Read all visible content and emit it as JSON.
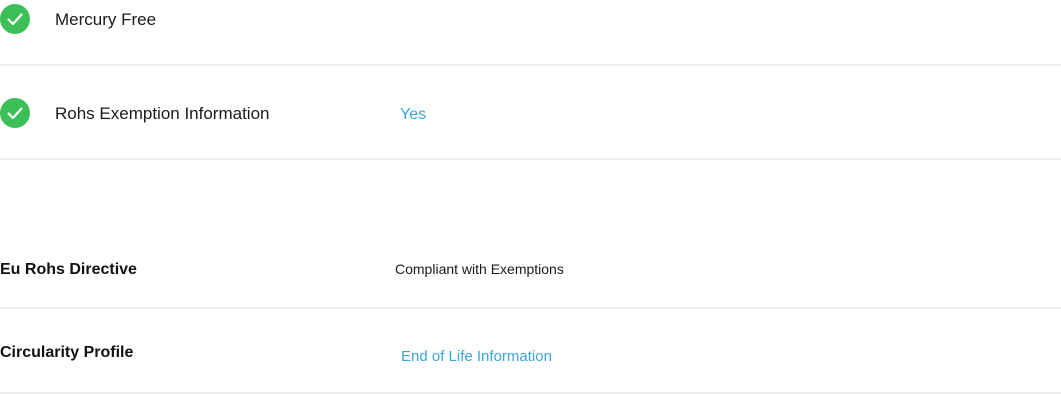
{
  "compliance_checks": [
    {
      "label": "Mercury Free",
      "icon": "check-circle-icon",
      "status_color": "#3dbf57"
    },
    {
      "label": "Rohs Exemption Information",
      "icon": "check-circle-icon",
      "status_color": "#3dbf57",
      "value": "Yes"
    }
  ],
  "attributes": [
    {
      "label": "Eu Rohs Directive",
      "value": "Compliant with Exemptions"
    },
    {
      "label": "Circularity Profile",
      "value": "End of Life Information"
    }
  ],
  "colors": {
    "link": "#3aa5dc",
    "check": "#3dbf57",
    "divider": "#ececec"
  }
}
